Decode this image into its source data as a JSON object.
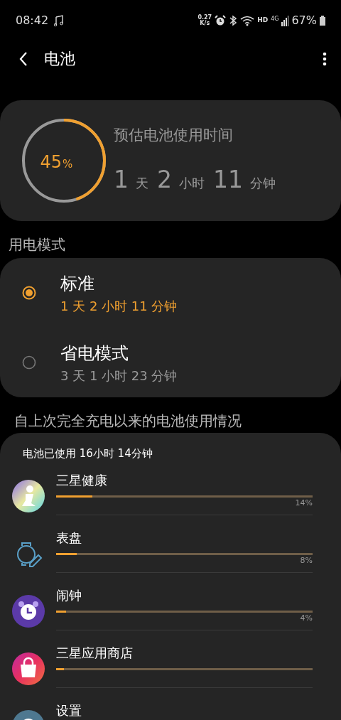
{
  "status_bar": {
    "time": "08:42",
    "speed_value": "0.27",
    "speed_unit": "K/s",
    "network_label": "HD",
    "network_type": "4G",
    "battery": "67%"
  },
  "toolbar": {
    "title": "电池"
  },
  "estimate": {
    "level": 0.45,
    "percent": "45",
    "percent_sign": "%",
    "title": "预估电池使用时间",
    "parts": [
      {
        "value": "1",
        "unit": "天"
      },
      {
        "value": "2",
        "unit": "小时"
      },
      {
        "value": "11",
        "unit": "分钟"
      }
    ]
  },
  "power_mode": {
    "header": "用电模式",
    "options": [
      {
        "name": "标准",
        "time": "1 天 2 小时 11 分钟",
        "selected": true
      },
      {
        "name": "省电模式",
        "time": "3 天 1 小时 23 分钟",
        "selected": false
      }
    ]
  },
  "usage": {
    "header": "自上次完全充电以来的电池使用情况",
    "summary": "电池已使用 16小时 14分钟",
    "apps": [
      {
        "kind": "health",
        "name": "三星健康",
        "level": 0.14,
        "percent": "14%"
      },
      {
        "kind": "watch",
        "name": "表盘",
        "level": 0.08,
        "percent": "8%"
      },
      {
        "kind": "alarm",
        "name": "闹钟",
        "level": 0.04,
        "percent": "4%"
      },
      {
        "kind": "store",
        "name": "三星应用商店",
        "level": 0.03
      },
      {
        "kind": "settings",
        "name": "设置"
      }
    ]
  }
}
